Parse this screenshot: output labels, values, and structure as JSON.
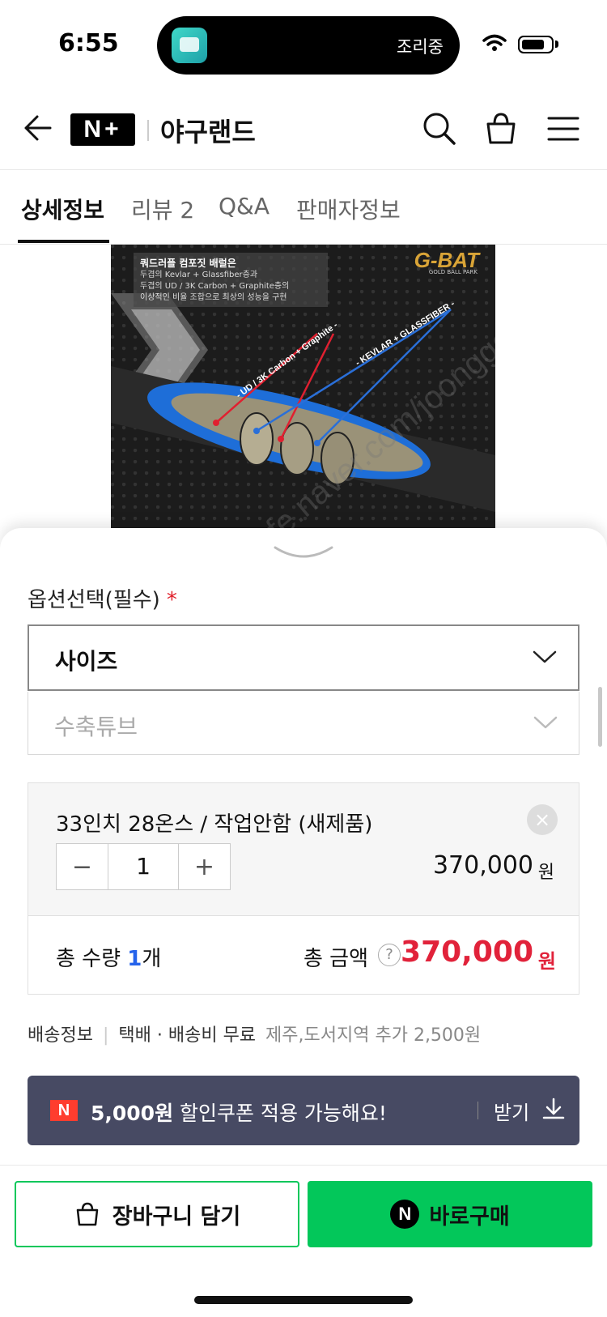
{
  "status_bar": {
    "time": "6:55",
    "island_app_text": "조리중",
    "battery_level": 0.8
  },
  "header": {
    "brand_badge": "N+",
    "store_name": "야구랜드"
  },
  "tabs": [
    {
      "label": "상세정보",
      "active": true
    },
    {
      "label": "리뷰 2",
      "active": false
    },
    {
      "label": "Q&A",
      "active": false
    },
    {
      "label": "판매자정보",
      "active": false
    }
  ],
  "product_image": {
    "caption_title": "쿼드러플 컴포짓 배럴은",
    "caption_lines": [
      "두겹의 Kevlar + Glassfiber층과",
      "두겹의 UD / 3K Carbon + Graphite층의",
      "이상적인 비율 조합으로 최상의 성능을 구현"
    ],
    "brand": "G-BAT",
    "brand_sub": "GOLD BALL PARK",
    "label_red": "- UD / 3K Carbon + Graphite -",
    "label_blue": "- KEVLAR + GLASSFIBER -"
  },
  "options": {
    "label": "옵션선택(필수)",
    "required_mark": "*",
    "select_size": "사이즈",
    "select_tube": "수축튜브"
  },
  "selected_item": {
    "name": "33인치 28온스 / 작업안함 (새제품)",
    "remove": "×",
    "minus": "−",
    "quantity": "1",
    "plus": "+",
    "price": "370,000",
    "won": "원"
  },
  "total": {
    "qty_label": "총 수량",
    "qty_value": "1",
    "qty_unit": "개",
    "amount_label": "총 금액",
    "help": "?",
    "amount": "370,000",
    "won": "원"
  },
  "shipping": {
    "label": "배송정보",
    "main": "택배 · 배송비 무료",
    "extra": "제주,도서지역 추가 2,500원"
  },
  "coupon": {
    "badge": "N",
    "amount": "5,000원",
    "text": " 할인쿠폰 적용 가능해요!",
    "get": "받기"
  },
  "buttons": {
    "cart": "장바구니 담기",
    "buy_badge": "N",
    "buy": "바로구매"
  },
  "colors": {
    "naver_green": "#03c75a",
    "price_red": "#e1223a",
    "coupon_bg": "#474a63",
    "coupon_badge": "#ff3d2e"
  }
}
